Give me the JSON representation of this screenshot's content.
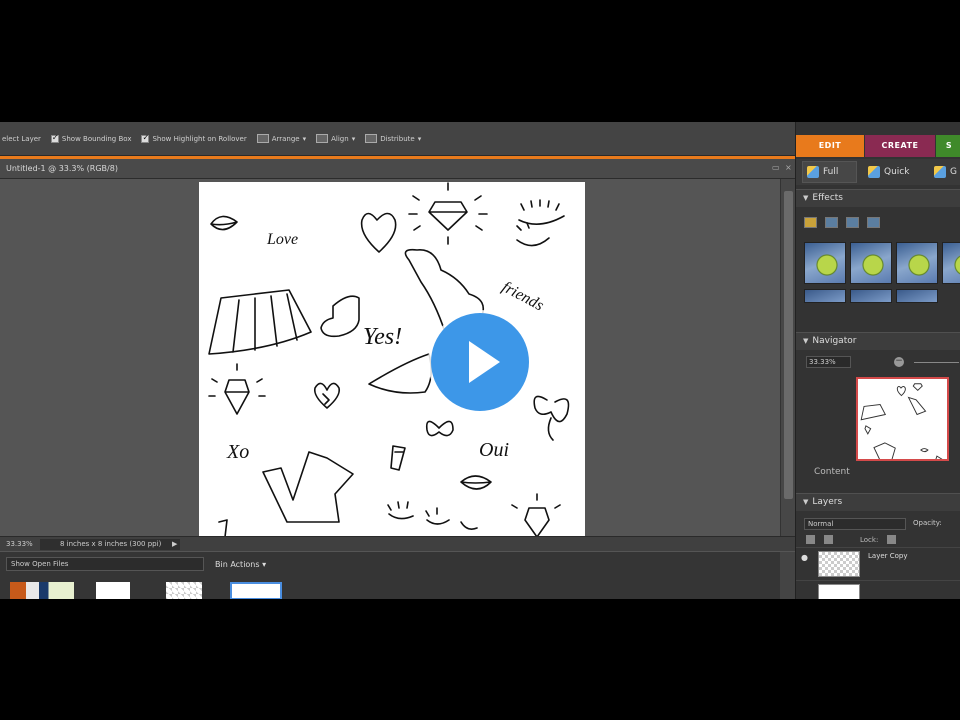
{
  "options_bar": {
    "select_layer": "elect Layer",
    "show_bounding_box": "Show Bounding Box",
    "show_highlight": "Show Highlight on Rollover",
    "arrange": "Arrange",
    "align": "Align",
    "distribute": "Distribute"
  },
  "document": {
    "title": "Untitled-1 @ 33.3% (RGB/8)",
    "minimize": "▭",
    "close": "×"
  },
  "canvas_text": {
    "love": "Love",
    "friends": "friends",
    "yes": "Yes!",
    "oui": "Oui",
    "xo": "Xo"
  },
  "status_bar": {
    "zoom": "33.33%",
    "doc_size": "8 inches x 8 inches (300 ppi)"
  },
  "project_bin": {
    "show_files": "Show Open Files",
    "bin_actions": "Bin Actions"
  },
  "mode_tabs": {
    "edit": "EDIT",
    "create": "CREATE",
    "share": "S"
  },
  "edit_tabs": {
    "full": "Full",
    "quick": "Quick",
    "guided": "G"
  },
  "effects": {
    "title": "Effects"
  },
  "navigator": {
    "title": "Navigator",
    "zoom": "33.33%"
  },
  "content": {
    "title": "Content"
  },
  "layers": {
    "title": "Layers",
    "blend_mode": "Normal",
    "opacity_label": "Opacity:",
    "lock_label": "Lock:",
    "layer1": "Layer Copy"
  },
  "colors": {
    "edit_tab": "#e87a1c",
    "create_tab": "#8a2a52",
    "share_tab": "#3f8a2a",
    "play_button": "#3d97e8"
  },
  "video_player": {
    "play_label": "Play"
  }
}
